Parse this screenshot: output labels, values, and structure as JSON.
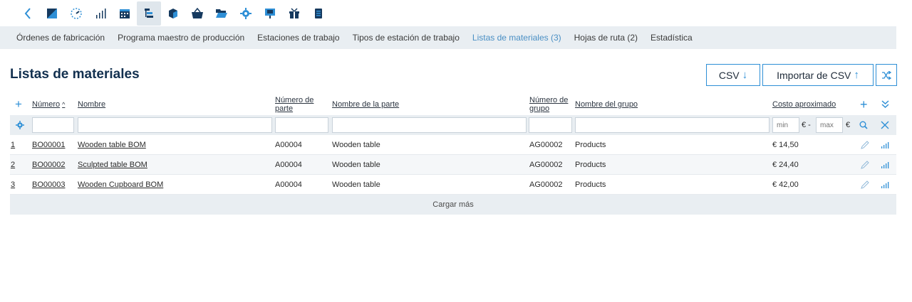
{
  "toolbar": {
    "icons": [
      "back-icon",
      "dashboard-icon",
      "gauge-icon",
      "bar-chart-icon",
      "calendar-icon",
      "tree-icon",
      "box-icon",
      "basket-icon",
      "folder-icon",
      "gear-icon",
      "presentation-icon",
      "gift-icon",
      "document-icon"
    ],
    "active": "tree-icon"
  },
  "subnav": [
    {
      "label": "Órdenes de fabricación",
      "current": false
    },
    {
      "label": "Programa maestro de producción",
      "current": false
    },
    {
      "label": "Estaciones de trabajo",
      "current": false
    },
    {
      "label": "Tipos de estación de trabajo",
      "current": false
    },
    {
      "label": "Listas de materiales (3)",
      "current": true
    },
    {
      "label": "Hojas de ruta (2)",
      "current": false
    },
    {
      "label": "Estadística",
      "current": false
    }
  ],
  "page": {
    "title": "Listas de materiales",
    "csv_label": "CSV",
    "import_label": "Importar de CSV"
  },
  "table": {
    "headers": {
      "number": "Número",
      "sort_indicator": "^",
      "name": "Nombre",
      "part_number_1": "Número de",
      "part_number_2": "parte",
      "part_name": "Nombre de la parte",
      "group_number_1": "Número de",
      "group_number_2": "grupo",
      "group_name": "Nombre del grupo",
      "cost": "Costo aproximado"
    },
    "filters": {
      "min_placeholder": "min",
      "max_placeholder": "max",
      "currency": "€",
      "range_sep": "€ -"
    },
    "rows": [
      {
        "idx": "1",
        "number": "BO00001",
        "name": "Wooden table BOM",
        "part_number": "A00004",
        "part_name": "Wooden table",
        "group_number": "AG00002",
        "group_name": "Products",
        "cost": "€ 14,50"
      },
      {
        "idx": "2",
        "number": "BO00002",
        "name": "Sculpted table BOM",
        "part_number": "A00004",
        "part_name": "Wooden table",
        "group_number": "AG00002",
        "group_name": "Products",
        "cost": "€ 24,40"
      },
      {
        "idx": "3",
        "number": "BO00003",
        "name": "Wooden Cupboard BOM",
        "part_number": "A00004",
        "part_name": "Wooden table",
        "group_number": "AG00002",
        "group_name": "Products",
        "cost": "€ 42,00"
      }
    ],
    "load_more": "Cargar más"
  },
  "colors": {
    "accent": "#2e8fd6",
    "navy": "#12304f",
    "panel": "#e9eef2"
  }
}
